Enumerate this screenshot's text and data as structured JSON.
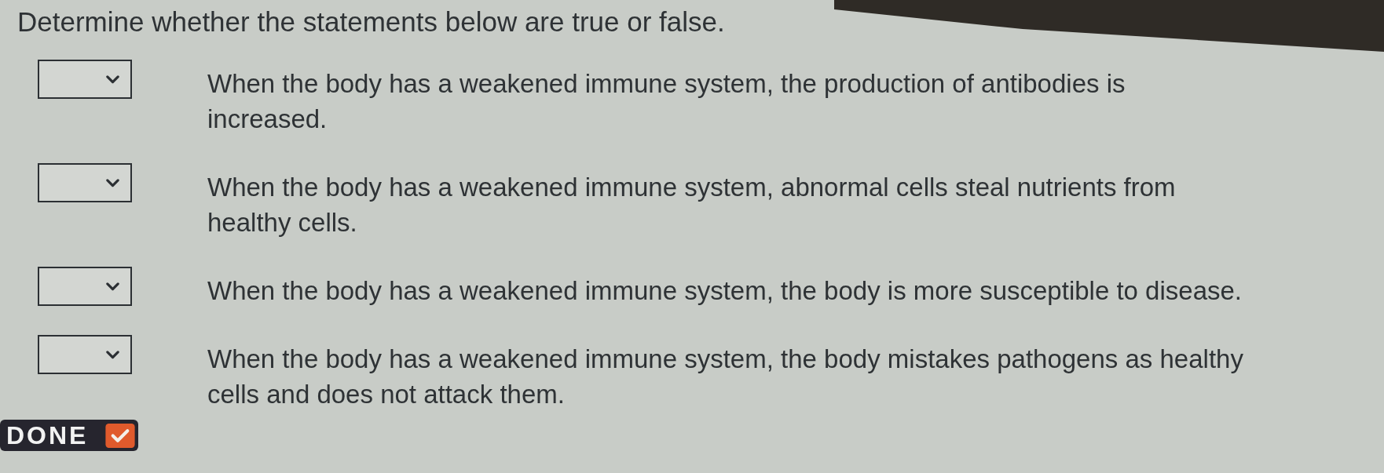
{
  "instructions": "Determine whether the statements below are true or false.",
  "statements": [
    {
      "lines": [
        "When the body has a weakened immune system, the production of antibodies is",
        "increased."
      ]
    },
    {
      "lines": [
        "When the body has a weakened immune system, abnormal cells steal nutrients from",
        "healthy cells."
      ]
    },
    {
      "lines": [
        "When the body has a weakened immune system, the body is more susceptible to disease."
      ]
    },
    {
      "lines": [
        "When the body has a weakened immune system, the body mistakes pathogens as healthy",
        "cells and does not attack them."
      ]
    }
  ],
  "done_button": {
    "label": "DONE"
  }
}
